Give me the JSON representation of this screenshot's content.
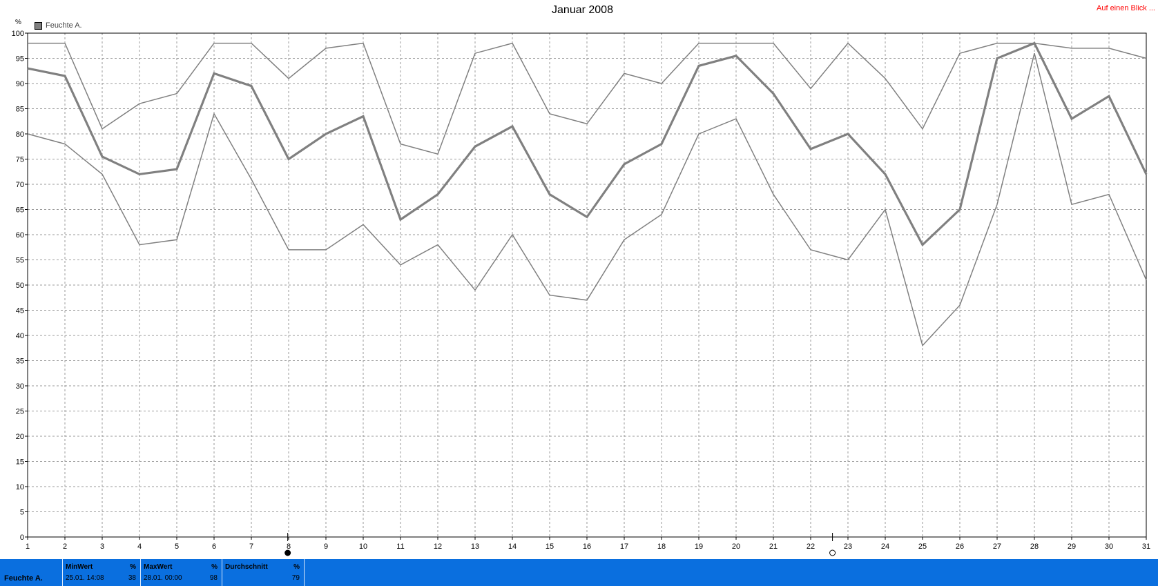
{
  "chart_data": {
    "type": "line",
    "title": "Januar 2008",
    "ylabel": "%",
    "ylim": [
      0,
      100
    ],
    "yticks": [
      0,
      5,
      10,
      15,
      20,
      25,
      30,
      35,
      40,
      45,
      50,
      55,
      60,
      65,
      70,
      75,
      80,
      85,
      90,
      95,
      100
    ],
    "x": [
      1,
      2,
      3,
      4,
      5,
      6,
      7,
      8,
      9,
      10,
      11,
      12,
      13,
      14,
      15,
      16,
      17,
      18,
      19,
      20,
      21,
      22,
      23,
      24,
      25,
      26,
      27,
      28,
      29,
      30,
      31
    ],
    "grid": true,
    "legend_placement": "top-left",
    "legend": [
      "Feuchte A."
    ],
    "series": [
      {
        "name": "Feuchte A.",
        "role": "max",
        "color": "#808080",
        "width": 1.5,
        "values": [
          98,
          98,
          81,
          86,
          88,
          98,
          98,
          91,
          97,
          98,
          78,
          76,
          96,
          98,
          84,
          82,
          92,
          90,
          98,
          98,
          98,
          89,
          98,
          91,
          81,
          96,
          98,
          98,
          97,
          97,
          95
        ]
      },
      {
        "name": "Feuchte A.",
        "role": "avg",
        "color": "#808080",
        "width": 3.2,
        "values": [
          93,
          91.5,
          75.5,
          72,
          73,
          92,
          89.5,
          75,
          80,
          83.5,
          63,
          68,
          77.5,
          81.5,
          68,
          63.5,
          74,
          78,
          93.5,
          95.5,
          88,
          77,
          80,
          72,
          58,
          65,
          95,
          98,
          83,
          87.5,
          72
        ]
      },
      {
        "name": "Feuchte A.",
        "role": "min",
        "color": "#808080",
        "width": 1.5,
        "values": [
          80,
          78,
          72,
          58,
          59,
          84,
          71,
          57,
          57,
          62,
          54,
          58,
          49,
          60,
          48,
          47,
          59,
          64,
          80,
          83,
          68,
          57,
          55,
          65,
          38,
          46,
          66,
          96,
          66,
          68,
          51
        ]
      }
    ]
  },
  "top_link": "Auf einen Blick ...",
  "stats": {
    "row_label": "Feuchte A.",
    "min": {
      "label": "MinWert",
      "unit": "%",
      "date": "25.01.  14:08",
      "value": "38"
    },
    "max": {
      "label": "MaxWert",
      "unit": "%",
      "date": "28.01.  00:00",
      "value": "98"
    },
    "avg": {
      "label": "Durchschnitt",
      "unit": "%",
      "value": "79"
    }
  }
}
